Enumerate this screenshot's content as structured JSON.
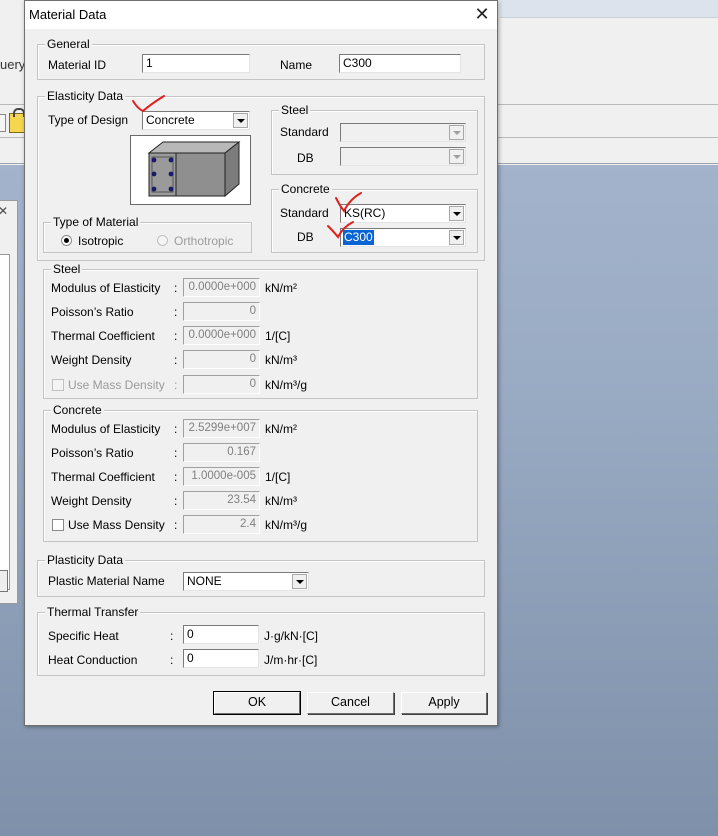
{
  "background": {
    "toolbar_fragment": "uery"
  },
  "dialog": {
    "title": "Material Data",
    "general": {
      "legend": "General",
      "material_id_label": "Material ID",
      "material_id": "1",
      "name_label": "Name",
      "name": "C300"
    },
    "elasticity": {
      "legend": "Elasticity Data",
      "type_of_design_label": "Type of Design",
      "type_of_design": "Concrete",
      "material_type": {
        "legend": "Type of Material",
        "isotropic": "Isotropic",
        "orthotropic": "Orthotropic",
        "selected": "Isotropic"
      },
      "steel_db": {
        "legend": "Steel",
        "standard_label": "Standard",
        "standard": "",
        "db_label": "DB",
        "db": ""
      },
      "concrete_db": {
        "legend": "Concrete",
        "standard_label": "Standard",
        "standard": "KS(RC)",
        "db_label": "DB",
        "db": "C300"
      }
    },
    "steel_props": {
      "legend": "Steel",
      "modulus_label": "Modulus of Elasticity",
      "modulus": "0.0000e+000",
      "modulus_unit": "kN/m²",
      "poisson_label": "Poisson’s Ratio",
      "poisson": "0",
      "thermal_label": "Thermal Coefficient",
      "thermal": "0.0000e+000",
      "thermal_unit": "1/[C]",
      "weight_label": "Weight Density",
      "weight": "0",
      "weight_unit": "kN/m³",
      "mass_label": "Use Mass Density",
      "mass": "0",
      "mass_unit": "kN/m³/g"
    },
    "concrete_props": {
      "legend": "Concrete",
      "modulus_label": "Modulus of Elasticity",
      "modulus": "2.5299e+007",
      "modulus_unit": "kN/m²",
      "poisson_label": "Poisson’s Ratio",
      "poisson": "0.167",
      "thermal_label": "Thermal Coefficient",
      "thermal": "1.0000e-005",
      "thermal_unit": "1/[C]",
      "weight_label": "Weight Density",
      "weight": "23.54",
      "weight_unit": "kN/m³",
      "mass_label": "Use Mass Density",
      "mass": "2.4",
      "mass_unit": "kN/m³/g"
    },
    "plasticity": {
      "legend": "Plasticity Data",
      "plastic_name_label": "Plastic Material Name",
      "plastic_name": "NONE"
    },
    "thermal_transfer": {
      "legend": "Thermal Transfer",
      "specific_heat_label": "Specific Heat",
      "specific_heat": "0",
      "specific_heat_unit": "J·g/kN·[C]",
      "heat_conduction_label": "Heat Conduction",
      "heat_conduction": "0",
      "heat_conduction_unit": "J/m·hr·[C]"
    },
    "buttons": {
      "ok": "OK",
      "cancel": "Cancel",
      "apply": "Apply"
    },
    "colon": ":"
  },
  "colors": {
    "annotation_red": "#e0201c",
    "selection_blue": "#0a64d2",
    "desktop_blue": "#9aabc4"
  },
  "icons": [
    "close-icon",
    "dropdown-arrow-icon",
    "lock-icon",
    "concrete-beam-section-icon",
    "annotation-checkmark-icon"
  ]
}
